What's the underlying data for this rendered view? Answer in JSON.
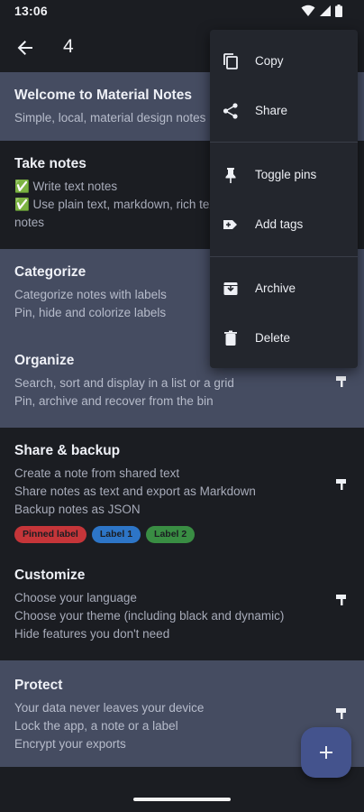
{
  "status_bar": {
    "time": "13:06",
    "icons": [
      "wifi-icon",
      "signal-icon",
      "battery-icon"
    ]
  },
  "app_bar": {
    "back_icon": "arrow-back-icon",
    "selected_count": "4"
  },
  "context_menu": {
    "items": [
      {
        "label": "Copy",
        "icon": "copy-icon"
      },
      {
        "label": "Share",
        "icon": "share-icon"
      },
      {
        "label": "Toggle pins",
        "icon": "pin-icon"
      },
      {
        "label": "Add tags",
        "icon": "label-add-icon"
      },
      {
        "label": "Archive",
        "icon": "archive-icon"
      },
      {
        "label": "Delete",
        "icon": "delete-icon"
      }
    ]
  },
  "notes": [
    {
      "title": "Welcome to Material Notes",
      "lines": [
        "Simple, local, material design notes"
      ],
      "selected": true
    },
    {
      "title": "Take notes",
      "lines": [
        "✅ Write text notes",
        "✅ Use plain text, markdown, rich text",
        "notes"
      ],
      "selected": false
    },
    {
      "title": "Categorize",
      "lines": [
        "Categorize notes with labels",
        "Pin, hide and colorize labels"
      ],
      "selected": true
    },
    {
      "title": "Organize",
      "lines": [
        "Search, sort and display in a list or a grid",
        "Pin, archive and recover from the bin"
      ],
      "selected": true
    },
    {
      "title": "Share & backup",
      "lines": [
        "Create a note from shared text",
        "Share notes as text and export as Markdown",
        "Backup notes as JSON"
      ],
      "labels": [
        {
          "text": "Pinned label",
          "color": "#d8383c"
        },
        {
          "text": "Label 1",
          "color": "#2f7fd9"
        },
        {
          "text": "Label 2",
          "color": "#3d9a47"
        }
      ],
      "selected": false
    },
    {
      "title": "Customize",
      "lines": [
        "Choose your language",
        "Choose your theme (including black and dynamic)",
        "Hide features you don't need"
      ],
      "selected": false
    },
    {
      "title": "Protect",
      "lines": [
        "Your data never leaves your device",
        "Lock the app, a note or a label",
        "Encrypt your exports"
      ],
      "selected": true
    }
  ],
  "fab": {
    "icon": "add-icon"
  },
  "colors": {
    "background": "#1b1d22",
    "selected_note": "#454c61",
    "menu": "#23262d",
    "fab": "#44538d"
  }
}
